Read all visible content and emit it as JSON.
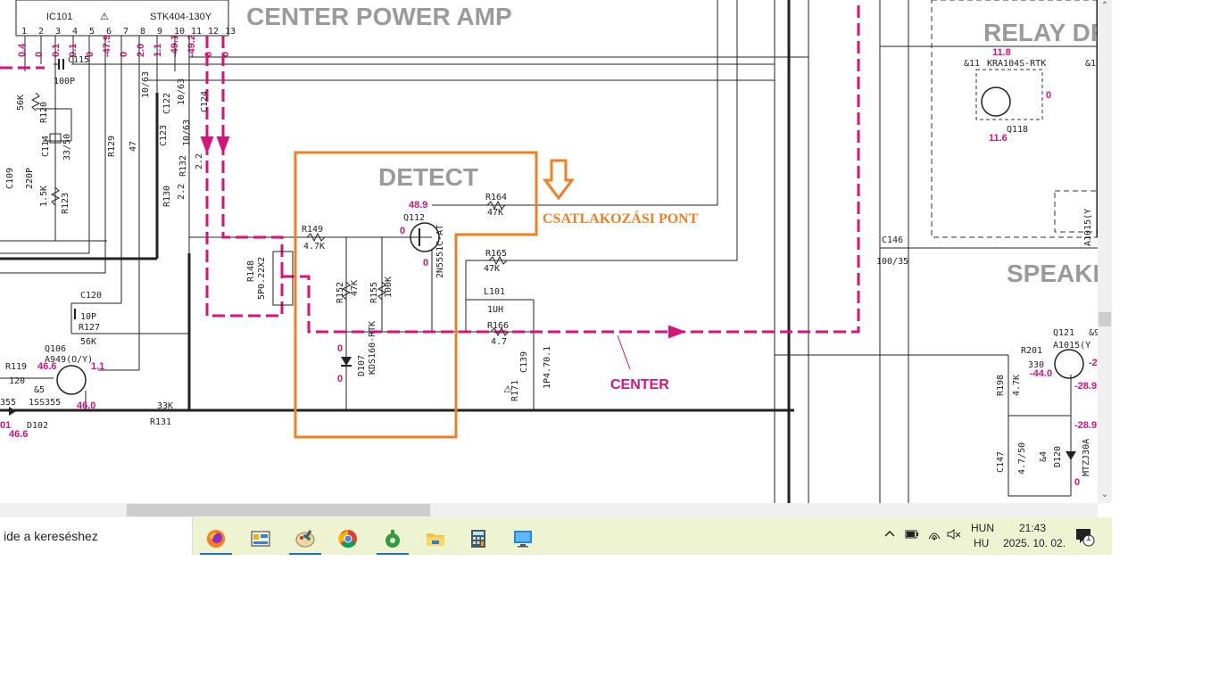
{
  "schematic": {
    "section_title": "CENTER POWER AMP",
    "relay_title": "RELAY DR",
    "speaker_title": "SPEAKE",
    "detect_label": "DETECT",
    "annotation": "CSATLAKOZÁSI PONT",
    "center_label": "CENTER",
    "ic_ref": "IC101",
    "ic_part": "STK404-130Y",
    "ic_pins": [
      "1",
      "2",
      "3",
      "4",
      "5",
      "6",
      "7",
      "8",
      "9",
      "10",
      "11",
      "12",
      "13"
    ],
    "ic_pin_volts": [
      "0.4",
      "0",
      "0.1",
      "0.1",
      "0",
      "-47.9",
      "0",
      "2.0",
      "1.1",
      "-49.1",
      "-49.2",
      "0",
      "0"
    ],
    "components": {
      "c115": "C115",
      "c115v": "100P",
      "r120": "R120",
      "r120v": "56K",
      "c114": "C114",
      "c114v": "33/50",
      "c109": "C109",
      "c109v": "220P",
      "r123": "R123",
      "r123v": "1.5K",
      "r129": "R129",
      "r129v": "47",
      "c123": "C123",
      "c123v": "10/63",
      "c122": "C122",
      "c122v": "10/63",
      "c124": "C124",
      "r130": "R130",
      "r130v": "2.2",
      "r132": "R132",
      "r132v": "2.2",
      "r148": "R148",
      "r148v": "5P0.22X2",
      "r149": "R149",
      "r149v": "4.7K",
      "r152": "R152",
      "r152v": "47K",
      "r155": "R155",
      "r155v": "100K",
      "q112": "Q112",
      "q112p": "2N5551C-AT",
      "r164": "R164",
      "r164v": "47K",
      "r165": "R165",
      "r165v": "47K",
      "l101": "L101",
      "l101v": "1UH",
      "r166": "R166",
      "r166v": "4.7",
      "c139": "C139",
      "c139v": "1P4.70.1",
      "r171": "R171",
      "d107": "D107",
      "d107p": "KDS160-RTK",
      "c120": "C120",
      "c120v": "10P",
      "r127": "R127",
      "r127v": "56K",
      "q106": "Q106",
      "q106p": "A949(O/Y)",
      "r119": "R119",
      "r119v": "120",
      "d102": "D102",
      "d102p": "1SS355",
      "d_left": "355",
      "r131": "R131",
      "r131v": "33K",
      "c146": "C146",
      "c146v": "100/35",
      "q118": "Q118",
      "q118p": "KRA104S-RTK",
      "q121": "Q121",
      "q121p": "A1015(Y",
      "r201": "R201",
      "r201v": "330",
      "r198": "R198",
      "r198v": "4.7K",
      "c147": "C147",
      "c147v": "4.7/50",
      "d120": "D120",
      "d120p": "MTZJ30A",
      "amp5": "&5",
      "amp4": "&4",
      "amp11": "&11",
      "amp1": "&1",
      "amp9": "&9"
    },
    "volts": {
      "q112_c": "48.9",
      "q112_b": "0",
      "q112_e": "0",
      "d107_a": "0",
      "d107_k": "0",
      "q106_a": "46.6",
      "q106_b": "1.1",
      "q106_c": "46.0",
      "d102_l": "01",
      "d102_v": "46.6",
      "q118_t": "11.8",
      "q118_r": "0",
      "q118_b": "11.6",
      "q121_l": "-44.0",
      "q121_r": "-2",
      "q121_v1": "-28.9",
      "q121_v2": "-28.9",
      "d120_v": "0"
    }
  },
  "taskbar": {
    "search_placeholder": "ide a kereséshez",
    "apps": [
      {
        "icon": "firefox-icon",
        "active": true
      },
      {
        "icon": "media-app-icon",
        "active": false
      },
      {
        "icon": "paint-icon",
        "active": true
      },
      {
        "icon": "chrome-icon",
        "active": false
      },
      {
        "icon": "green-app-icon",
        "active": true
      },
      {
        "icon": "file-explorer-icon",
        "active": false
      },
      {
        "icon": "calculator-icon",
        "active": false
      },
      {
        "icon": "remote-desktop-icon",
        "active": false
      }
    ],
    "lang_top": "HUN",
    "lang_bottom": "HU",
    "time": "21:43",
    "date": "2025. 10. 02.",
    "notification_count": "1"
  }
}
